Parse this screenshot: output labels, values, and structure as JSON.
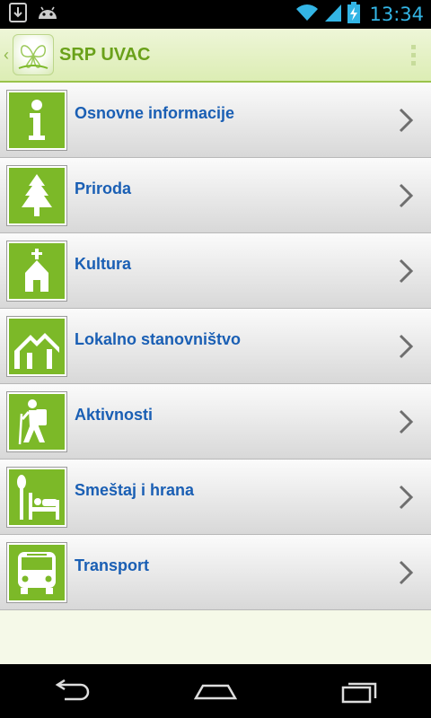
{
  "status_bar": {
    "time": "13:34",
    "icons": [
      "download-icon",
      "android-icon",
      "wifi-icon",
      "signal-icon",
      "battery-charging-icon"
    ]
  },
  "action_bar": {
    "title": "SRP UVAC",
    "logo": "butterfly-logo-icon",
    "menu": "overflow-menu-icon"
  },
  "menu": {
    "items": [
      {
        "label": "Osnovne informacije",
        "icon": "info-icon"
      },
      {
        "label": "Priroda",
        "icon": "tree-icon"
      },
      {
        "label": "Kultura",
        "icon": "church-icon"
      },
      {
        "label": "Lokalno stanovništvo",
        "icon": "house-icon"
      },
      {
        "label": "Aktivnosti",
        "icon": "hiker-icon"
      },
      {
        "label": "Smeštaj i hrana",
        "icon": "bed-fork-icon"
      },
      {
        "label": "Transport",
        "icon": "bus-icon"
      }
    ]
  },
  "nav_bar": {
    "buttons": [
      "back-icon",
      "home-icon",
      "recents-icon"
    ]
  },
  "colors": {
    "accent_green": "#7cb928",
    "title_green": "#6aa11a",
    "label_blue": "#1a5fb4",
    "system_blue": "#33b5e5"
  }
}
